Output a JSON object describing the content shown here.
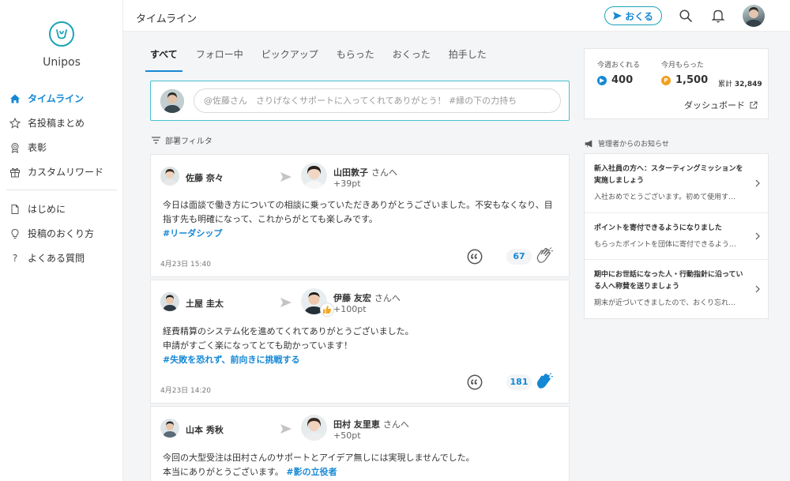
{
  "app": {
    "name": "Unipos"
  },
  "sidebar": {
    "items": [
      {
        "label": "タイムライン",
        "icon": "home-icon",
        "active": true
      },
      {
        "label": "名投稿まとめ",
        "icon": "star-icon"
      },
      {
        "label": "表彰",
        "icon": "award-icon"
      },
      {
        "label": "カスタムリワード",
        "icon": "gift-icon"
      }
    ],
    "help_items": [
      {
        "label": "はじめに",
        "icon": "document-icon"
      },
      {
        "label": "投稿のおくり方",
        "icon": "lightbulb-icon"
      },
      {
        "label": "よくある質問",
        "icon": "question-icon"
      }
    ]
  },
  "header": {
    "title": "タイムライン",
    "send_label": "おくる"
  },
  "tabs": [
    "すべて",
    "フォロー中",
    "ピックアップ",
    "もらった",
    "おくった",
    "拍手した"
  ],
  "composer": {
    "placeholder": "@佐藤さん　さりげなくサポートに入ってくれてありがとう！ #縁の下の力持ち"
  },
  "filter_label": "部署フィルタ",
  "posts": [
    {
      "sender": "佐藤 奈々",
      "receiver": "山田敦子",
      "receiver_suffix": "さんへ",
      "points": "+39pt",
      "body": [
        "今日は面談で働き方についての相談に乗っていただきありがとうございました。不安もなくなり、目",
        "指す先も明確になって、これからがとても楽しみです。"
      ],
      "hashtag": "#リーダシップ",
      "date": "4月23日 15:40",
      "claps": "67"
    },
    {
      "sender": "土屋 圭太",
      "receiver": "伊藤 友宏",
      "receiver_suffix": "さんへ",
      "points": "+100pt",
      "body": [
        "経費精算のシステム化を進めてくれてありがとうございました。",
        "申請がすごく楽になってとても助かっています！"
      ],
      "hashtag": "#失敗を恐れず、前向きに挑戦する",
      "date": "4月23日 14:20",
      "claps": "181"
    },
    {
      "sender": "山本 秀秋",
      "receiver": "田村 友里恵",
      "receiver_suffix": "さんへ",
      "points": "+50pt",
      "body": [
        "今回の大型受注は田村さんのサポートとアイデア無しには実現しませんでした。",
        "本当にありがとうございます。"
      ],
      "hashtag": "#影の立役者"
    }
  ],
  "stats": {
    "sent_label": "今週おくれる",
    "sent_value": "400",
    "received_label": "今月もらった",
    "received_value": "1,500",
    "cumulative_label": "累計",
    "cumulative_value": "32,849",
    "dashboard_label": "ダッシュボード"
  },
  "notices": {
    "title": "管理者からのお知らせ",
    "items": [
      {
        "title": "新入社員の方へ：スターティングミッションを実施しましょう",
        "preview": "入社おめでとうございます。初めて使用す…"
      },
      {
        "title": "ポイントを寄付できるようになりました",
        "preview": "もらったポイントを団体に寄付できるよう…"
      },
      {
        "title": "期中にお世話になった人・行動指針に沿っている人へ称賛を送りましょう",
        "preview": "期末が近づいてきましたので、おくり忘れ…"
      }
    ]
  },
  "colors": {
    "accent": "#1588d4",
    "teal": "#1aa3b8",
    "coin_orange": "#f0a020"
  }
}
